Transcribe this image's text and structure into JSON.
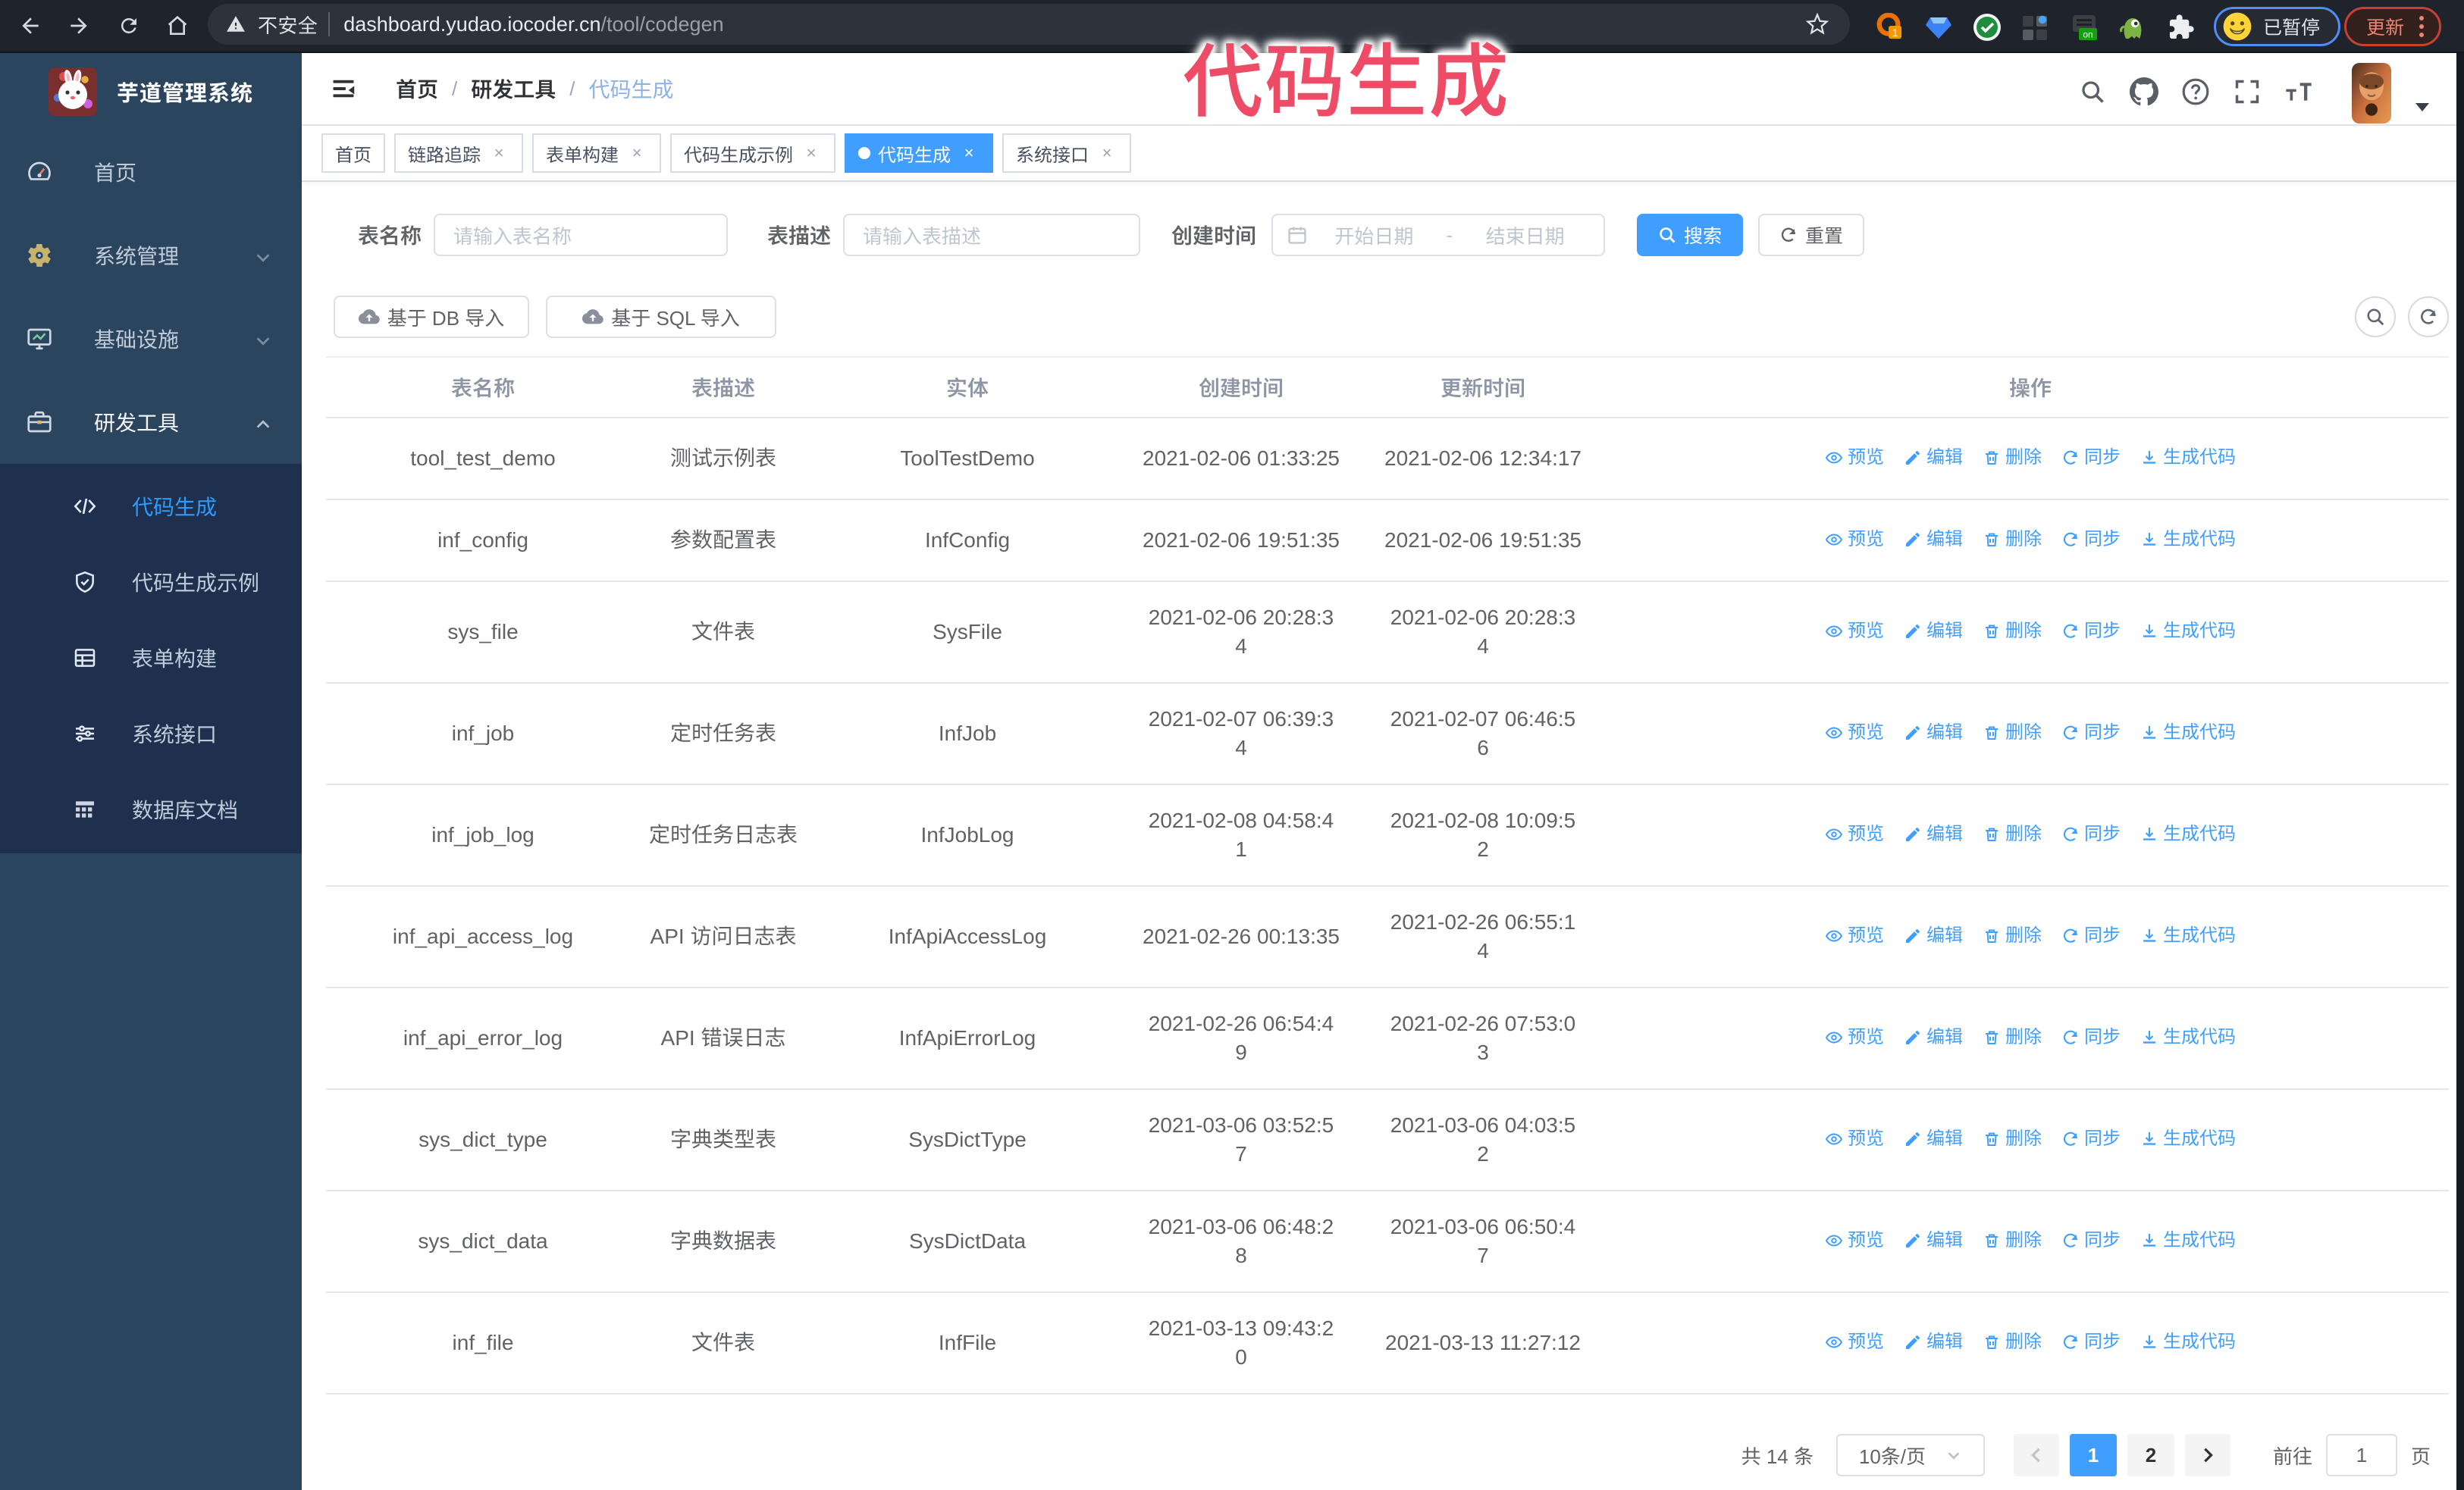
{
  "browser": {
    "security_label": "不安全",
    "url_domain": "dashboard.yudao.iocoder.cn",
    "url_path": "/tool/codegen",
    "profile_status": "已暂停",
    "update_label": "更新"
  },
  "annotation": {
    "text": "代码生成",
    "color": "#ee4b66"
  },
  "sidebar": {
    "logo_title": "芋道管理系统",
    "items": [
      {
        "label": "首页",
        "icon": "dashboard-icon",
        "arrow": ""
      },
      {
        "label": "系统管理",
        "icon": "gear-icon",
        "arrow": "down"
      },
      {
        "label": "基础设施",
        "icon": "monitor-icon",
        "arrow": "down"
      },
      {
        "label": "研发工具",
        "icon": "toolbox-icon",
        "arrow": "up",
        "active": true
      }
    ],
    "submenu": [
      {
        "label": "代码生成",
        "icon": "code-icon",
        "active": true
      },
      {
        "label": "代码生成示例",
        "icon": "shield-check-icon"
      },
      {
        "label": "表单构建",
        "icon": "form-icon"
      },
      {
        "label": "系统接口",
        "icon": "sliders-icon"
      },
      {
        "label": "数据库文档",
        "icon": "db-table-icon"
      }
    ]
  },
  "breadcrumb": {
    "items": [
      "首页",
      "研发工具",
      "代码生成"
    ],
    "separator": "/"
  },
  "tabs": [
    {
      "label": "首页",
      "closable": false,
      "active": false
    },
    {
      "label": "链路追踪",
      "closable": true,
      "active": false
    },
    {
      "label": "表单构建",
      "closable": true,
      "active": false
    },
    {
      "label": "代码生成示例",
      "closable": true,
      "active": false
    },
    {
      "label": "代码生成",
      "closable": true,
      "active": true
    },
    {
      "label": "系统接口",
      "closable": true,
      "active": false
    }
  ],
  "filters": {
    "table_name_label": "表名称",
    "table_name_placeholder": "请输入表名称",
    "table_desc_label": "表描述",
    "table_desc_placeholder": "请输入表描述",
    "create_time_label": "创建时间",
    "date_start_placeholder": "开始日期",
    "date_separator": "-",
    "date_end_placeholder": "结束日期",
    "search_label": "搜索",
    "reset_label": "重置"
  },
  "toolbar": {
    "import_db_label": "基于 DB 导入",
    "import_sql_label": "基于 SQL 导入"
  },
  "table": {
    "columns": [
      "表名称",
      "表描述",
      "实体",
      "创建时间",
      "更新时间",
      "操作"
    ],
    "actions": [
      {
        "label": "预览",
        "icon": "eye-icon"
      },
      {
        "label": "编辑",
        "icon": "edit-icon"
      },
      {
        "label": "删除",
        "icon": "delete-icon"
      },
      {
        "label": "同步",
        "icon": "sync-icon"
      },
      {
        "label": "生成代码",
        "icon": "download-icon"
      }
    ],
    "rows": [
      {
        "name": "tool_test_demo",
        "desc": "测试示例表",
        "entity": "ToolTestDemo",
        "create_time": "2021-02-06 01:33:25",
        "update_time": "2021-02-06 12:34:17"
      },
      {
        "name": "inf_config",
        "desc": "参数配置表",
        "entity": "InfConfig",
        "create_time": "2021-02-06 19:51:35",
        "update_time": "2021-02-06 19:51:35"
      },
      {
        "name": "sys_file",
        "desc": "文件表",
        "entity": "SysFile",
        "create_time": "2021-02-06 20:28:3\n4",
        "update_time": "2021-02-06 20:28:3\n4"
      },
      {
        "name": "inf_job",
        "desc": "定时任务表",
        "entity": "InfJob",
        "create_time": "2021-02-07 06:39:3\n4",
        "update_time": "2021-02-07 06:46:5\n6"
      },
      {
        "name": "inf_job_log",
        "desc": "定时任务日志表",
        "entity": "InfJobLog",
        "create_time": "2021-02-08 04:58:4\n1",
        "update_time": "2021-02-08 10:09:5\n2"
      },
      {
        "name": "inf_api_access_log",
        "desc": "API 访问日志表",
        "entity": "InfApiAccessLog",
        "create_time": "2021-02-26 00:13:35",
        "update_time": "2021-02-26 06:55:1\n4"
      },
      {
        "name": "inf_api_error_log",
        "desc": "API 错误日志",
        "entity": "InfApiErrorLog",
        "create_time": "2021-02-26 06:54:4\n9",
        "update_time": "2021-02-26 07:53:0\n3"
      },
      {
        "name": "sys_dict_type",
        "desc": "字典类型表",
        "entity": "SysDictType",
        "create_time": "2021-03-06 03:52:5\n7",
        "update_time": "2021-03-06 04:03:5\n2"
      },
      {
        "name": "sys_dict_data",
        "desc": "字典数据表",
        "entity": "SysDictData",
        "create_time": "2021-03-06 06:48:2\n8",
        "update_time": "2021-03-06 06:50:4\n7"
      },
      {
        "name": "inf_file",
        "desc": "文件表",
        "entity": "InfFile",
        "create_time": "2021-03-13 09:43:2\n0",
        "update_time": "2021-03-13 11:27:12"
      }
    ]
  },
  "pagination": {
    "total_label": "共 14 条",
    "page_size_label": "10条/页",
    "pages": [
      "1",
      "2"
    ],
    "active_page": "1",
    "goto_label": "前往",
    "goto_value": "1",
    "goto_suffix": "页"
  },
  "colors": {
    "primary": "#409eff",
    "annotation_pink": "#ee4b66",
    "sidebar_bg": "#2c455e",
    "submenu_bg": "#1e304d"
  }
}
